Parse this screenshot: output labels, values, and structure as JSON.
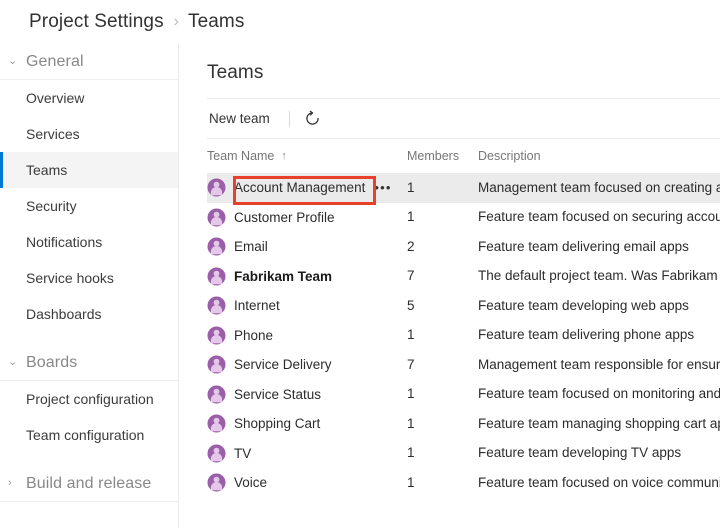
{
  "breadcrumb": {
    "parent": "Project Settings",
    "separator": "›",
    "current": "Teams"
  },
  "sidebar": {
    "groups": [
      {
        "label": "General",
        "chevron": "⌄",
        "expanded": true,
        "items": [
          {
            "label": "Overview",
            "selected": false
          },
          {
            "label": "Services",
            "selected": false
          },
          {
            "label": "Teams",
            "selected": true
          },
          {
            "label": "Security",
            "selected": false
          },
          {
            "label": "Notifications",
            "selected": false
          },
          {
            "label": "Service hooks",
            "selected": false
          },
          {
            "label": "Dashboards",
            "selected": false
          }
        ]
      },
      {
        "label": "Boards",
        "chevron": "⌄",
        "expanded": true,
        "items": [
          {
            "label": "Project configuration",
            "selected": false
          },
          {
            "label": "Team configuration",
            "selected": false
          }
        ]
      },
      {
        "label": "Build and release",
        "chevron": "›",
        "expanded": false,
        "items": []
      }
    ]
  },
  "main": {
    "title": "Teams",
    "toolbar": {
      "new_team_label": "New team",
      "refresh_icon": "refresh-icon"
    },
    "table": {
      "columns": {
        "name": "Team Name",
        "sort_arrow": "↑",
        "members": "Members",
        "description": "Description"
      },
      "rows": [
        {
          "name": "Account Management",
          "members": "1",
          "description": "Management team focused on creating an",
          "bold": false,
          "highlighted": true,
          "show_menu": true,
          "menu_label": "•••"
        },
        {
          "name": "Customer Profile",
          "members": "1",
          "description": "Feature team focused on securing account",
          "bold": false,
          "highlighted": false,
          "show_menu": false,
          "menu_label": ""
        },
        {
          "name": "Email",
          "members": "2",
          "description": "Feature team delivering email apps",
          "bold": false,
          "highlighted": false,
          "show_menu": false,
          "menu_label": ""
        },
        {
          "name": "Fabrikam Team",
          "members": "7",
          "description": "The default project team. Was Fabrikam Fi",
          "bold": true,
          "highlighted": false,
          "show_menu": false,
          "menu_label": ""
        },
        {
          "name": "Internet",
          "members": "5",
          "description": "Feature team developing web apps",
          "bold": false,
          "highlighted": false,
          "show_menu": false,
          "menu_label": ""
        },
        {
          "name": "Phone",
          "members": "1",
          "description": "Feature team delivering phone apps",
          "bold": false,
          "highlighted": false,
          "show_menu": false,
          "menu_label": ""
        },
        {
          "name": "Service Delivery",
          "members": "7",
          "description": "Management team responsible for ensure",
          "bold": false,
          "highlighted": false,
          "show_menu": false,
          "menu_label": ""
        },
        {
          "name": "Service Status",
          "members": "1",
          "description": "Feature team focused on monitoring and .",
          "bold": false,
          "highlighted": false,
          "show_menu": false,
          "menu_label": ""
        },
        {
          "name": "Shopping Cart",
          "members": "1",
          "description": "Feature team managing shopping cart app",
          "bold": false,
          "highlighted": false,
          "show_menu": false,
          "menu_label": ""
        },
        {
          "name": "TV",
          "members": "1",
          "description": "Feature team developing TV apps",
          "bold": false,
          "highlighted": false,
          "show_menu": false,
          "menu_label": ""
        },
        {
          "name": "Voice",
          "members": "1",
          "description": "Feature team focused on voice communic",
          "bold": false,
          "highlighted": false,
          "show_menu": false,
          "menu_label": ""
        }
      ]
    }
  },
  "colors": {
    "accent": "#0078d4",
    "annotation": "#e8402a",
    "avatar": "#9a5fa8",
    "row_highlight": "#ebebeb"
  }
}
